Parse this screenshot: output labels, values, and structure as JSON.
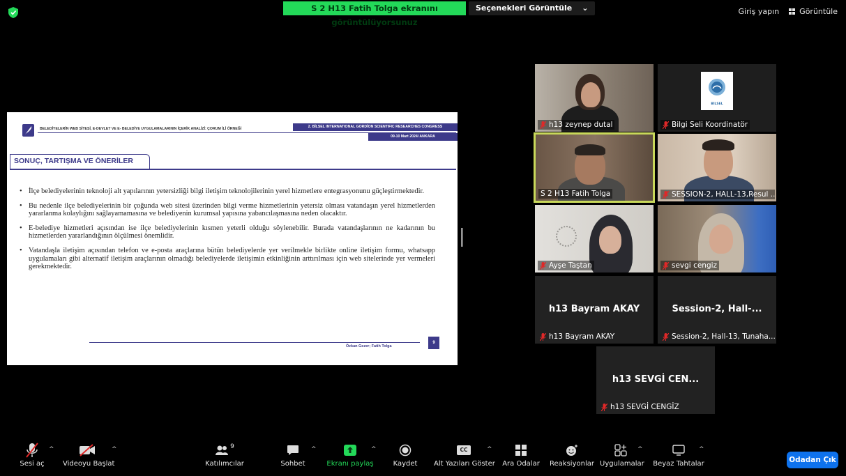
{
  "top_bar": {
    "share_banner": "S 2 H13 Fatih Tolga ekranını görüntülüyorsunuz",
    "view_options": "Seçenekleri Görüntüle",
    "sign_in": "Giriş yapın",
    "view": "Görüntüle"
  },
  "slide": {
    "doc_title": "BELEDİYELERİN WEB SİTESİ, E-DEVLET VE E- BELEDİYE UYGULAMALARININ İÇERİK ANALİZİ: ÇORUM İLİ ÖRNEĞİ",
    "congress": "2. BİLSEL INTERNATIONAL GORDİON SCIENTIFIC RESEARCHES CONGRESS",
    "date": "09-10 Mart 2024/ ANKARA",
    "section": "SONUÇ, TARTIŞMA VE ÖNERİLER",
    "bullets": [
      "İlçe belediyelerinin teknoloji alt yapılarının yetersizliği bilgi iletişim teknolojilerinin yerel hizmetlere entegrasyonunu güçleştirmektedir.",
      "Bu nedenle ilçe belediyelerinin bir çoğunda web sitesi üzerinden bilgi verme hizmetlerinin yetersiz olması vatandaşın yerel hizmetlerden yararlanma kolaylığını sağlayamamasına ve belediyenin kurumsal yapısına yabancılaşmasına neden olacaktır.",
      "E-belediye hizmetleri açısından ise ilçe belediyelerinin kısmen yeterli olduğu söylenebilir. Burada vatandaşlarının ne kadarının bu hizmetlerden yararlandığının ölçülmesi önemlidir.",
      "Vatandaşla iletişim açısından telefon ve e-posta araçlarına bütün belediyelerde yer verilmekle birlikte online iletişim formu, whatsapp uygulamaları gibi alternatif iletişim araçlarının olmadığı belediyelerde iletişimin etkinliğinin arttırılması için web sitelerinde yer vermeleri gerekmektedir."
    ],
    "authors": "Özkan Gezer; Fatih Tolga",
    "page": "9"
  },
  "participants": [
    {
      "name": "h13 zeynep dutal"
    },
    {
      "name": "Bilgi Seli  Koordinatör"
    },
    {
      "name": "S 2 H13 Fatih Tolga"
    },
    {
      "name": "SESSION-2, HALL-13,Resul ..."
    },
    {
      "name": "Ayşe Taştan"
    },
    {
      "name": "sevgi cengiz"
    },
    {
      "name": "h13 Bayram AKAY",
      "display": "h13 Bayram AKAY"
    },
    {
      "name": "Session-2, Hall-13, Tunaha...",
      "display": "Session-2,  Hall-..."
    },
    {
      "name": "h13 SEVGİ CENGİZ",
      "display": "h13 SEVGİ CEN..."
    }
  ],
  "coordinator_logo_text": "BİLSEL",
  "toolbar": {
    "unmute": "Sesi aç",
    "start_video": "Videoyu Başlat",
    "participants": "Katılımcılar",
    "participants_count": "9",
    "chat": "Sohbet",
    "share": "Ekranı paylaş",
    "record": "Kaydet",
    "captions": "Alt Yazıları Göster",
    "captions_icon_text": "CC",
    "breakout": "Ara Odalar",
    "reactions": "Reaksiyonlar",
    "apps": "Uygulamalar",
    "whiteboards": "Beyaz Tahtalar",
    "leave": "Odadan Çık"
  },
  "colors": {
    "share_green": "#23d959",
    "slide_accent": "#3d3a8a",
    "active_speaker": "#c8d85a",
    "leave_blue": "#0e72ed",
    "muted_red": "#e02828"
  }
}
